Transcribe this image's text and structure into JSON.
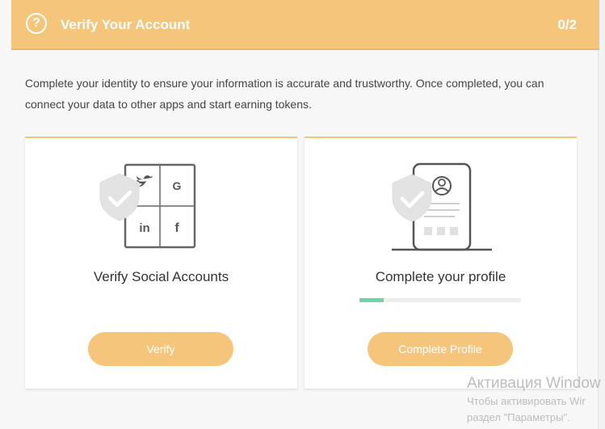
{
  "header": {
    "icon": "question-mark-icon",
    "icon_glyph": "?",
    "title": "Verify Your Account",
    "progress": "0/2"
  },
  "description": "Complete your identity to ensure your information is accurate and trustworthy. Once completed, you can connect your data to other apps and start earning tokens.",
  "cards": [
    {
      "title": "Verify Social Accounts",
      "button_label": "Verify",
      "social_icons": [
        "twitter-icon",
        "google-icon",
        "linkedin-icon",
        "facebook-icon"
      ],
      "social_glyphs": [
        "G",
        "in",
        "f"
      ]
    },
    {
      "title": "Complete your profile",
      "button_label": "Complete Profile",
      "progress_fraction": 0.15
    }
  ],
  "watermark": {
    "title": "Активация Window",
    "line1": "Чтобы активировать Wir",
    "line2": "раздел \"Параметры\"."
  },
  "colors": {
    "accent": "#f6c57c",
    "progress": "#6ed6a6",
    "shield": "#e3e3e3"
  }
}
